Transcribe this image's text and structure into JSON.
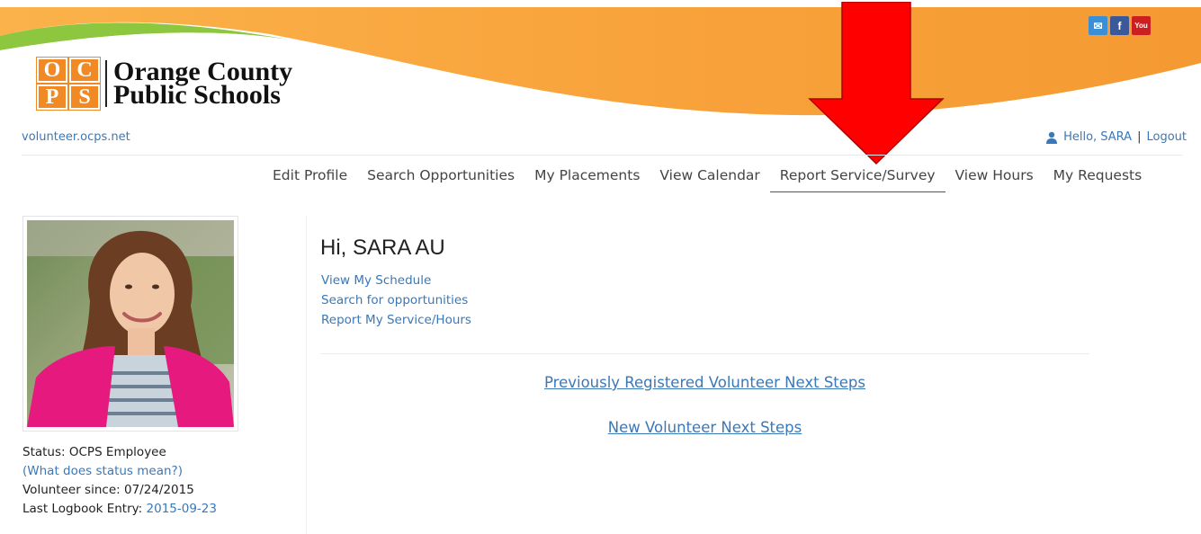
{
  "header": {
    "logo_letters": [
      "O",
      "C",
      "P",
      "S"
    ],
    "logo_line1": "Orange County",
    "logo_line2": "Public Schools",
    "social": {
      "mail": "✉",
      "facebook": "f",
      "youtube": "You"
    },
    "site_link": "volunteer.ocps.net",
    "greeting_user": "Hello, SARA",
    "separator": "|",
    "logout": "Logout"
  },
  "nav": {
    "items": [
      {
        "label": "Edit Profile"
      },
      {
        "label": "Search Opportunities"
      },
      {
        "label": "My Placements"
      },
      {
        "label": "View Calendar"
      },
      {
        "label": "Report Service/Survey",
        "active": true
      },
      {
        "label": "View Hours"
      },
      {
        "label": "My Requests"
      }
    ]
  },
  "profile": {
    "status_label": "Status:",
    "status_value": "OCPS Employee",
    "status_help": "(What does status mean?)",
    "since_label": "Volunteer since:",
    "since_value": "07/24/2015",
    "logbook_label": "Last Logbook Entry:",
    "logbook_value": "2015-09-23"
  },
  "main": {
    "greeting": "Hi, SARA AU",
    "quick_links": [
      "View My Schedule",
      "Search for opportunities",
      "Report My Service/Hours"
    ],
    "previous_steps": "Previously Registered Volunteer Next Steps",
    "new_steps": "New Volunteer Next Steps"
  },
  "colors": {
    "banner_orange": "#f7a23a",
    "banner_green": "#8dc63f",
    "link_blue": "#3a78b8",
    "arrow_red": "#ff0000"
  }
}
